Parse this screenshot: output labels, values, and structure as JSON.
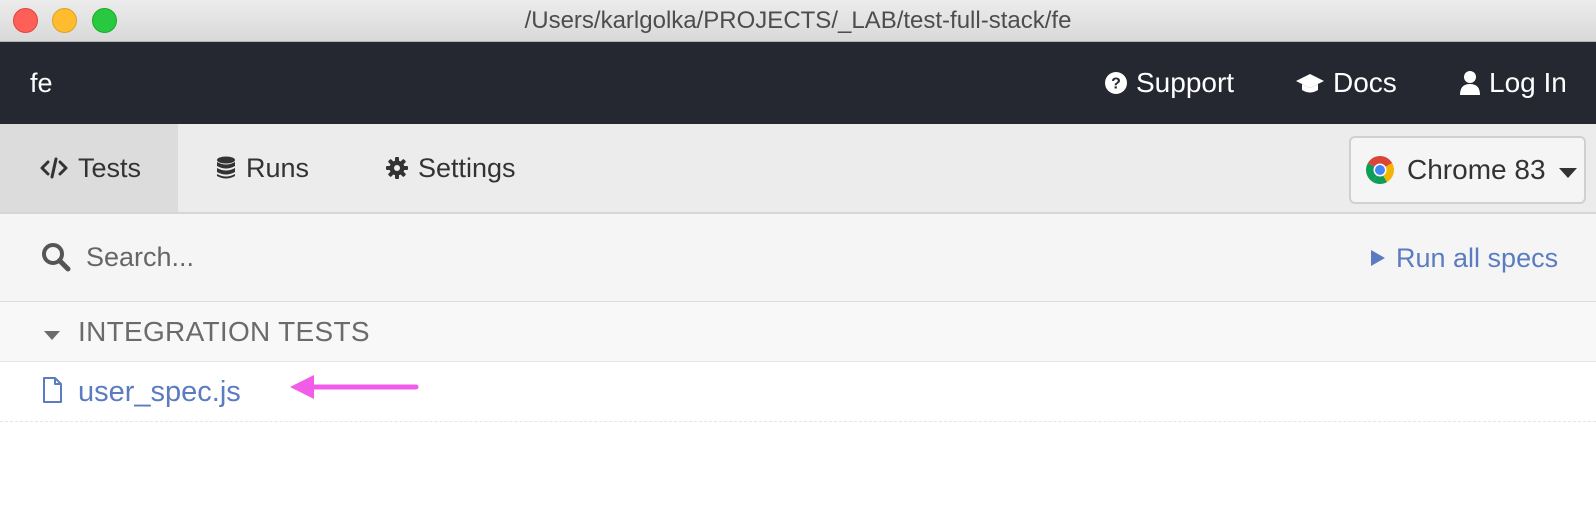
{
  "window": {
    "title": "/Users/karlgolka/PROJECTS/_LAB/test-full-stack/fe"
  },
  "header": {
    "project_name": "fe",
    "links": {
      "support": "Support",
      "docs": "Docs",
      "login": "Log In"
    }
  },
  "nav": {
    "tabs": {
      "tests": "Tests",
      "runs": "Runs",
      "settings": "Settings"
    },
    "active_tab": "Tests",
    "browser": {
      "label": "Chrome 83",
      "icon": "chrome-logo-icon"
    }
  },
  "search": {
    "placeholder": "Search...",
    "value": ""
  },
  "run_all": {
    "label": "Run all specs"
  },
  "specs": {
    "folder_label": "INTEGRATION TESTS",
    "files": [
      {
        "name": "user_spec.js"
      }
    ]
  },
  "annotation": {
    "arrow_color": "#f25ce8"
  },
  "colors": {
    "header_bg": "#252830",
    "link_blue": "#5b7cc0",
    "nav_bg": "#ececec"
  }
}
